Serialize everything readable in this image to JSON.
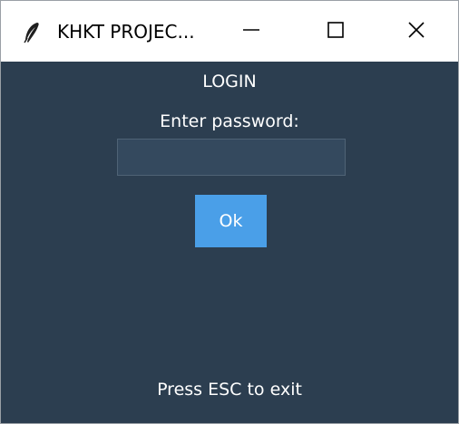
{
  "window": {
    "title": "KHKT PROJEC...",
    "app_icon": "feather-icon",
    "controls": {
      "minimize_icon": "minimize-icon",
      "maximize_icon": "maximize-icon",
      "close_icon": "close-icon"
    }
  },
  "login": {
    "heading": "LOGIN",
    "prompt": "Enter password:",
    "password_value": "",
    "ok_label": "Ok",
    "exit_hint": "Press ESC to exit"
  },
  "colors": {
    "background": "#2c3e50",
    "input_background": "#34495e",
    "button_accent": "#4a9fe8",
    "text": "#ffffff"
  }
}
